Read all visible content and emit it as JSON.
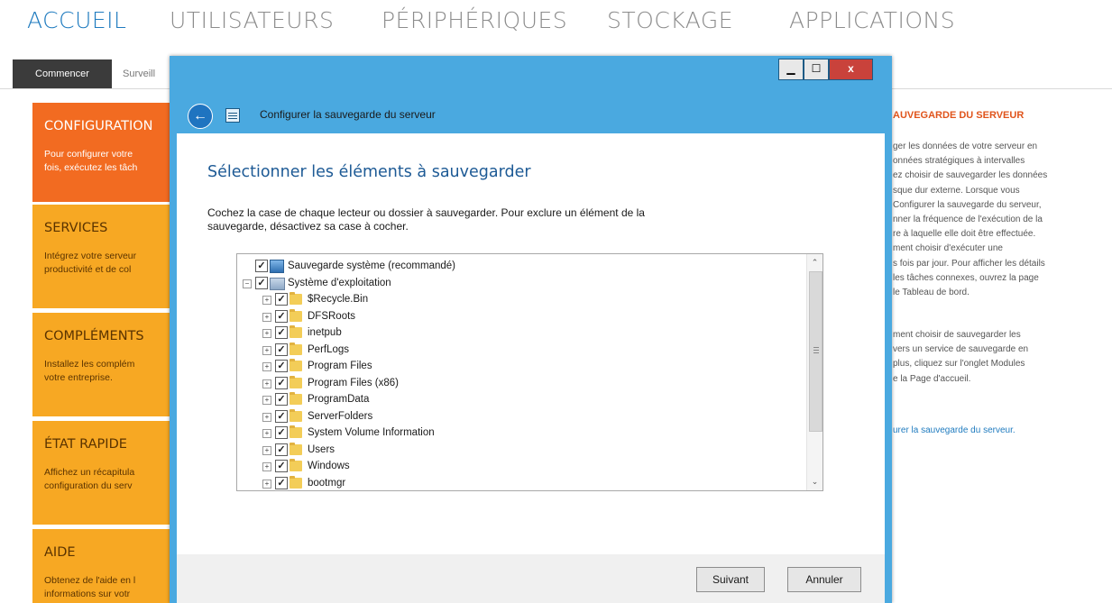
{
  "nav": {
    "tabs": [
      "ACCUEIL",
      "UTILISATEURS",
      "PÉRIPHÉRIQUES",
      "STOCKAGE",
      "APPLICATIONS"
    ]
  },
  "subnav": {
    "active": "Commencer",
    "item": "Surveill"
  },
  "tiles": [
    {
      "title": "CONFIGURATION",
      "line1": "Pour configurer votre",
      "line2": "fois, exécutez les tâch"
    },
    {
      "title": "SERVICES",
      "line1": "Intégrez votre serveur",
      "line2": "productivité et de col"
    },
    {
      "title": "COMPLÉMENTS",
      "line1": "Installez les complém",
      "line2": "votre entreprise."
    },
    {
      "title": "ÉTAT RAPIDE",
      "line1": "Affichez un récapitula",
      "line2": "configuration du serv"
    },
    {
      "title": "AIDE",
      "line1": "Obtenez de l'aide en l",
      "line2": "informations sur votr"
    }
  ],
  "right_panel": {
    "heading": "AUVEGARDE DU SERVEUR",
    "para1": [
      "ger les données de votre serveur en",
      "onnées stratégiques à intervalles",
      "ez choisir de sauvegarder les données",
      "sque dur externe. Lorsque vous",
      "Configurer la sauvegarde du serveur,",
      "nner la fréquence de l'exécution de la",
      "re à laquelle elle doit être effectuée.",
      "ment choisir d'exécuter une",
      "s fois par jour.  Pour afficher les détails",
      " les tâches connexes, ouvrez la page",
      "le Tableau de bord."
    ],
    "para2": [
      "ment choisir de sauvegarder les",
      "vers un service de sauvegarde en",
      " plus, cliquez sur l'onglet Modules",
      "e la Page d'accueil."
    ],
    "link": "urer la sauvegarde du serveur."
  },
  "dialog": {
    "title": "Configurer la sauvegarde du serveur",
    "heading": "Sélectionner les éléments à sauvegarder",
    "instr_line1": "Cochez la case de chaque lecteur ou dossier à sauvegarder. Pour exclure un élément de la",
    "instr_line2": "sauvegarde, désactivez sa case à cocher.",
    "controls": {
      "minimize": "▁",
      "maximize": "☐",
      "close": "x"
    },
    "tree": [
      {
        "label": "Sauvegarde système (recommandé)",
        "level": 0,
        "icon": "system-icon",
        "checked": true
      },
      {
        "label": "Système d'exploitation",
        "level": 0,
        "icon": "os-drive-icon",
        "checked": true
      },
      {
        "label": "$Recycle.Bin",
        "level": 1,
        "icon": "folder-icon",
        "checked": true
      },
      {
        "label": "DFSRoots",
        "level": 1,
        "icon": "folder-icon",
        "checked": true
      },
      {
        "label": "inetpub",
        "level": 1,
        "icon": "folder-icon",
        "checked": true
      },
      {
        "label": "PerfLogs",
        "level": 1,
        "icon": "folder-icon",
        "checked": true
      },
      {
        "label": "Program Files",
        "level": 1,
        "icon": "folder-icon",
        "checked": true
      },
      {
        "label": "Program Files (x86)",
        "level": 1,
        "icon": "folder-icon",
        "checked": true
      },
      {
        "label": "ProgramData",
        "level": 1,
        "icon": "folder-icon",
        "checked": true
      },
      {
        "label": "ServerFolders",
        "level": 1,
        "icon": "folder-icon",
        "checked": true
      },
      {
        "label": "System Volume Information",
        "level": 1,
        "icon": "folder-icon",
        "checked": true
      },
      {
        "label": "Users",
        "level": 1,
        "icon": "folder-icon",
        "checked": true
      },
      {
        "label": "Windows",
        "level": 1,
        "icon": "folder-icon",
        "checked": true
      },
      {
        "label": "bootmgr",
        "level": 1,
        "icon": "file-icon",
        "checked": true
      }
    ],
    "buttons": {
      "next": "Suivant",
      "cancel": "Annuler"
    }
  },
  "colors": {
    "accent": "#1f7bbf",
    "titlebar": "#4aa9e0",
    "tile_orange": "#f26b21",
    "tile_yellow": "#f7a823"
  }
}
